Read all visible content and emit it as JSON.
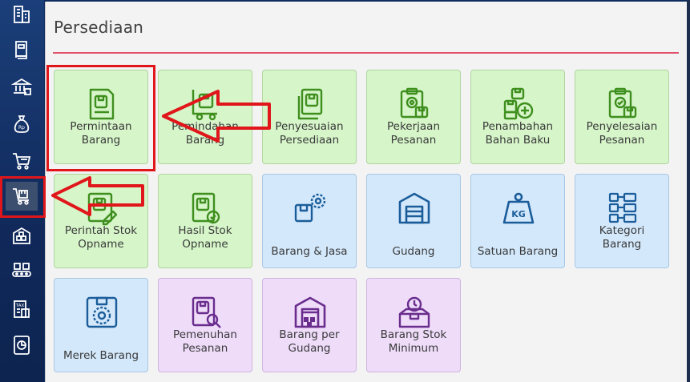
{
  "page": {
    "title": "Persediaan"
  },
  "sidebar": {
    "items": [
      {
        "icon": "building-icon"
      },
      {
        "icon": "book-icon"
      },
      {
        "icon": "bank-icon"
      },
      {
        "icon": "money-bag-icon"
      },
      {
        "icon": "shopping-cart-icon"
      },
      {
        "icon": "inventory-cart-icon",
        "active": true
      },
      {
        "icon": "warehouse-boxes-icon"
      },
      {
        "icon": "production-line-icon"
      },
      {
        "icon": "tax-document-icon"
      },
      {
        "icon": "report-chart-icon"
      }
    ]
  },
  "tiles": [
    {
      "label": "Permintaan\nBarang",
      "color": "green",
      "icon": "request-document-icon"
    },
    {
      "label": "Pemindahan\nBarang",
      "color": "green",
      "icon": "transfer-trolley-icon"
    },
    {
      "label": "Penyesuaian\nPersediaan",
      "color": "green",
      "icon": "adjustment-document-icon"
    },
    {
      "label": "Pekerjaan\nPesanan",
      "color": "green",
      "icon": "work-order-clipboard-icon"
    },
    {
      "label": "Penambahan\nBahan Baku",
      "color": "green",
      "icon": "add-material-icon"
    },
    {
      "label": "Penyelesaian\nPesanan",
      "color": "green",
      "icon": "order-complete-clipboard-icon"
    },
    {
      "label": "Perintah Stok\nOpname",
      "color": "green",
      "icon": "stock-opname-edit-icon"
    },
    {
      "label": "Hasil Stok\nOpname",
      "color": "green",
      "icon": "stock-opname-result-icon"
    },
    {
      "label": "Barang & Jasa",
      "color": "blue",
      "icon": "goods-services-icon"
    },
    {
      "label": "Gudang",
      "color": "blue",
      "icon": "warehouse-icon"
    },
    {
      "label": "Satuan Barang",
      "color": "blue",
      "icon": "weight-kg-icon"
    },
    {
      "label": "Kategori\nBarang",
      "color": "blue",
      "icon": "category-grid-icon"
    },
    {
      "label": "Merek Barang",
      "color": "blue",
      "icon": "brand-tag-icon"
    },
    {
      "label": "Pemenuhan\nPesanan",
      "color": "purple",
      "icon": "fulfillment-search-icon"
    },
    {
      "label": "Barang per\nGudang",
      "color": "purple",
      "icon": "warehouse-goods-icon"
    },
    {
      "label": "Barang Stok\nMinimum",
      "color": "purple",
      "icon": "minimum-stock-box-icon"
    }
  ],
  "colors": {
    "green_tile": "#d6f5c9",
    "green_icon": "#3f8f1f",
    "blue_tile": "#d3e8fb",
    "blue_icon": "#1b5d9a",
    "purple_tile": "#eedcf9",
    "purple_icon": "#6a2d8e",
    "highlight": "#e0161b",
    "title_rule": "#e0516a"
  }
}
